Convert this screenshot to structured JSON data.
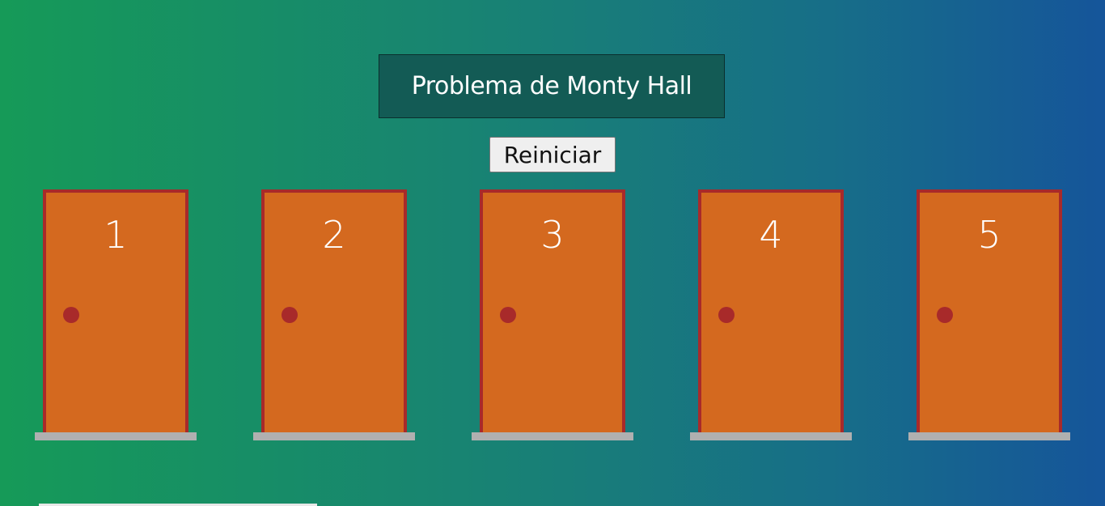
{
  "header": {
    "title": "Problema de Monty Hall"
  },
  "controls": {
    "reset_label": "Reiniciar"
  },
  "doors": [
    {
      "number": "1"
    },
    {
      "number": "2"
    },
    {
      "number": "3"
    },
    {
      "number": "4"
    },
    {
      "number": "5"
    }
  ],
  "colors": {
    "door": "#d4691f",
    "door_frame": "#a82a2a",
    "knob": "#a82a2a",
    "sill": "#b0b0b0",
    "title_box": "#135b55"
  }
}
